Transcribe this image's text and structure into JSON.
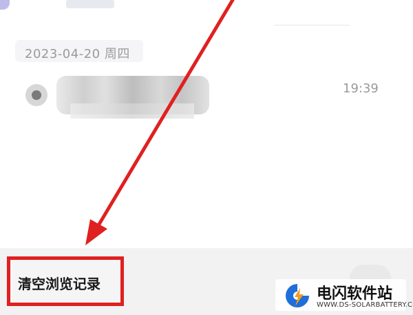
{
  "history": {
    "date_label": "2023-04-20 周四",
    "entries": [
      {
        "time": "19:39"
      }
    ]
  },
  "footer": {
    "clear_label": "清空浏览记录"
  },
  "watermark": {
    "title": "电闪软件站",
    "url": "WWW.DS-SOLARBATTERY.COM"
  },
  "colors": {
    "highlight": "#e02020",
    "arrow": "#e02020",
    "logo_blue": "#1e6fd9",
    "logo_orange": "#f39a1f"
  },
  "icons": {
    "arrow": "red-arrow-icon",
    "entry": "site-favicon-icon",
    "watermark": "lightning-logo-icon"
  }
}
